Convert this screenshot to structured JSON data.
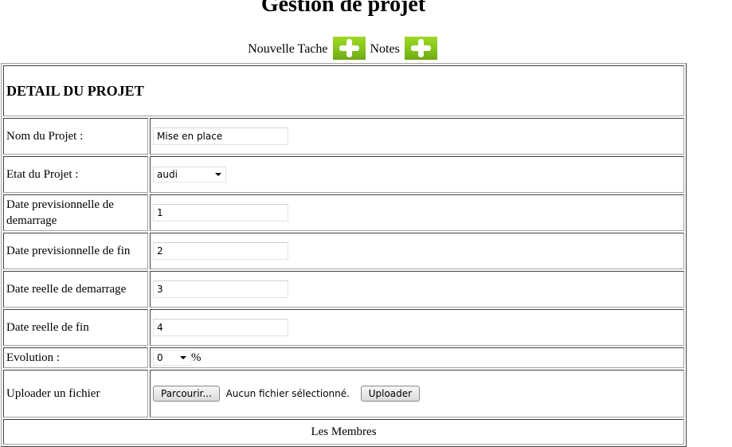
{
  "page": {
    "title": "Gestion de projet"
  },
  "actions": {
    "new_task_label": "Nouvelle Tache",
    "new_task_icon": "plus-icon",
    "notes_label": "Notes",
    "notes_icon": "plus-icon",
    "icon_color": "#86c41d"
  },
  "section": {
    "heading": "DETAIL DU PROJET"
  },
  "form": {
    "nom": {
      "label": "Nom du Projet :",
      "value": "Mise en place"
    },
    "etat": {
      "label": "Etat du Projet :",
      "selected": "audi"
    },
    "date_prev_debut": {
      "label": "Date previsionnelle de demarrage",
      "value": "1"
    },
    "date_prev_fin": {
      "label": "Date previsionnelle de fin",
      "value": "2"
    },
    "date_reel_debut": {
      "label": "Date reelle de demarrage",
      "value": "3"
    },
    "date_reel_fin": {
      "label": "Date reelle de fin",
      "value": "4"
    },
    "evolution": {
      "label": "Evolution :",
      "selected": "0",
      "unit": "%"
    },
    "upload": {
      "label": "Uploader un fichier",
      "browse_label": "Parcourir...",
      "file_status": "Aucun fichier sélectionné.",
      "upload_label": "Uploader"
    }
  },
  "members": {
    "heading": "Les Membres"
  }
}
